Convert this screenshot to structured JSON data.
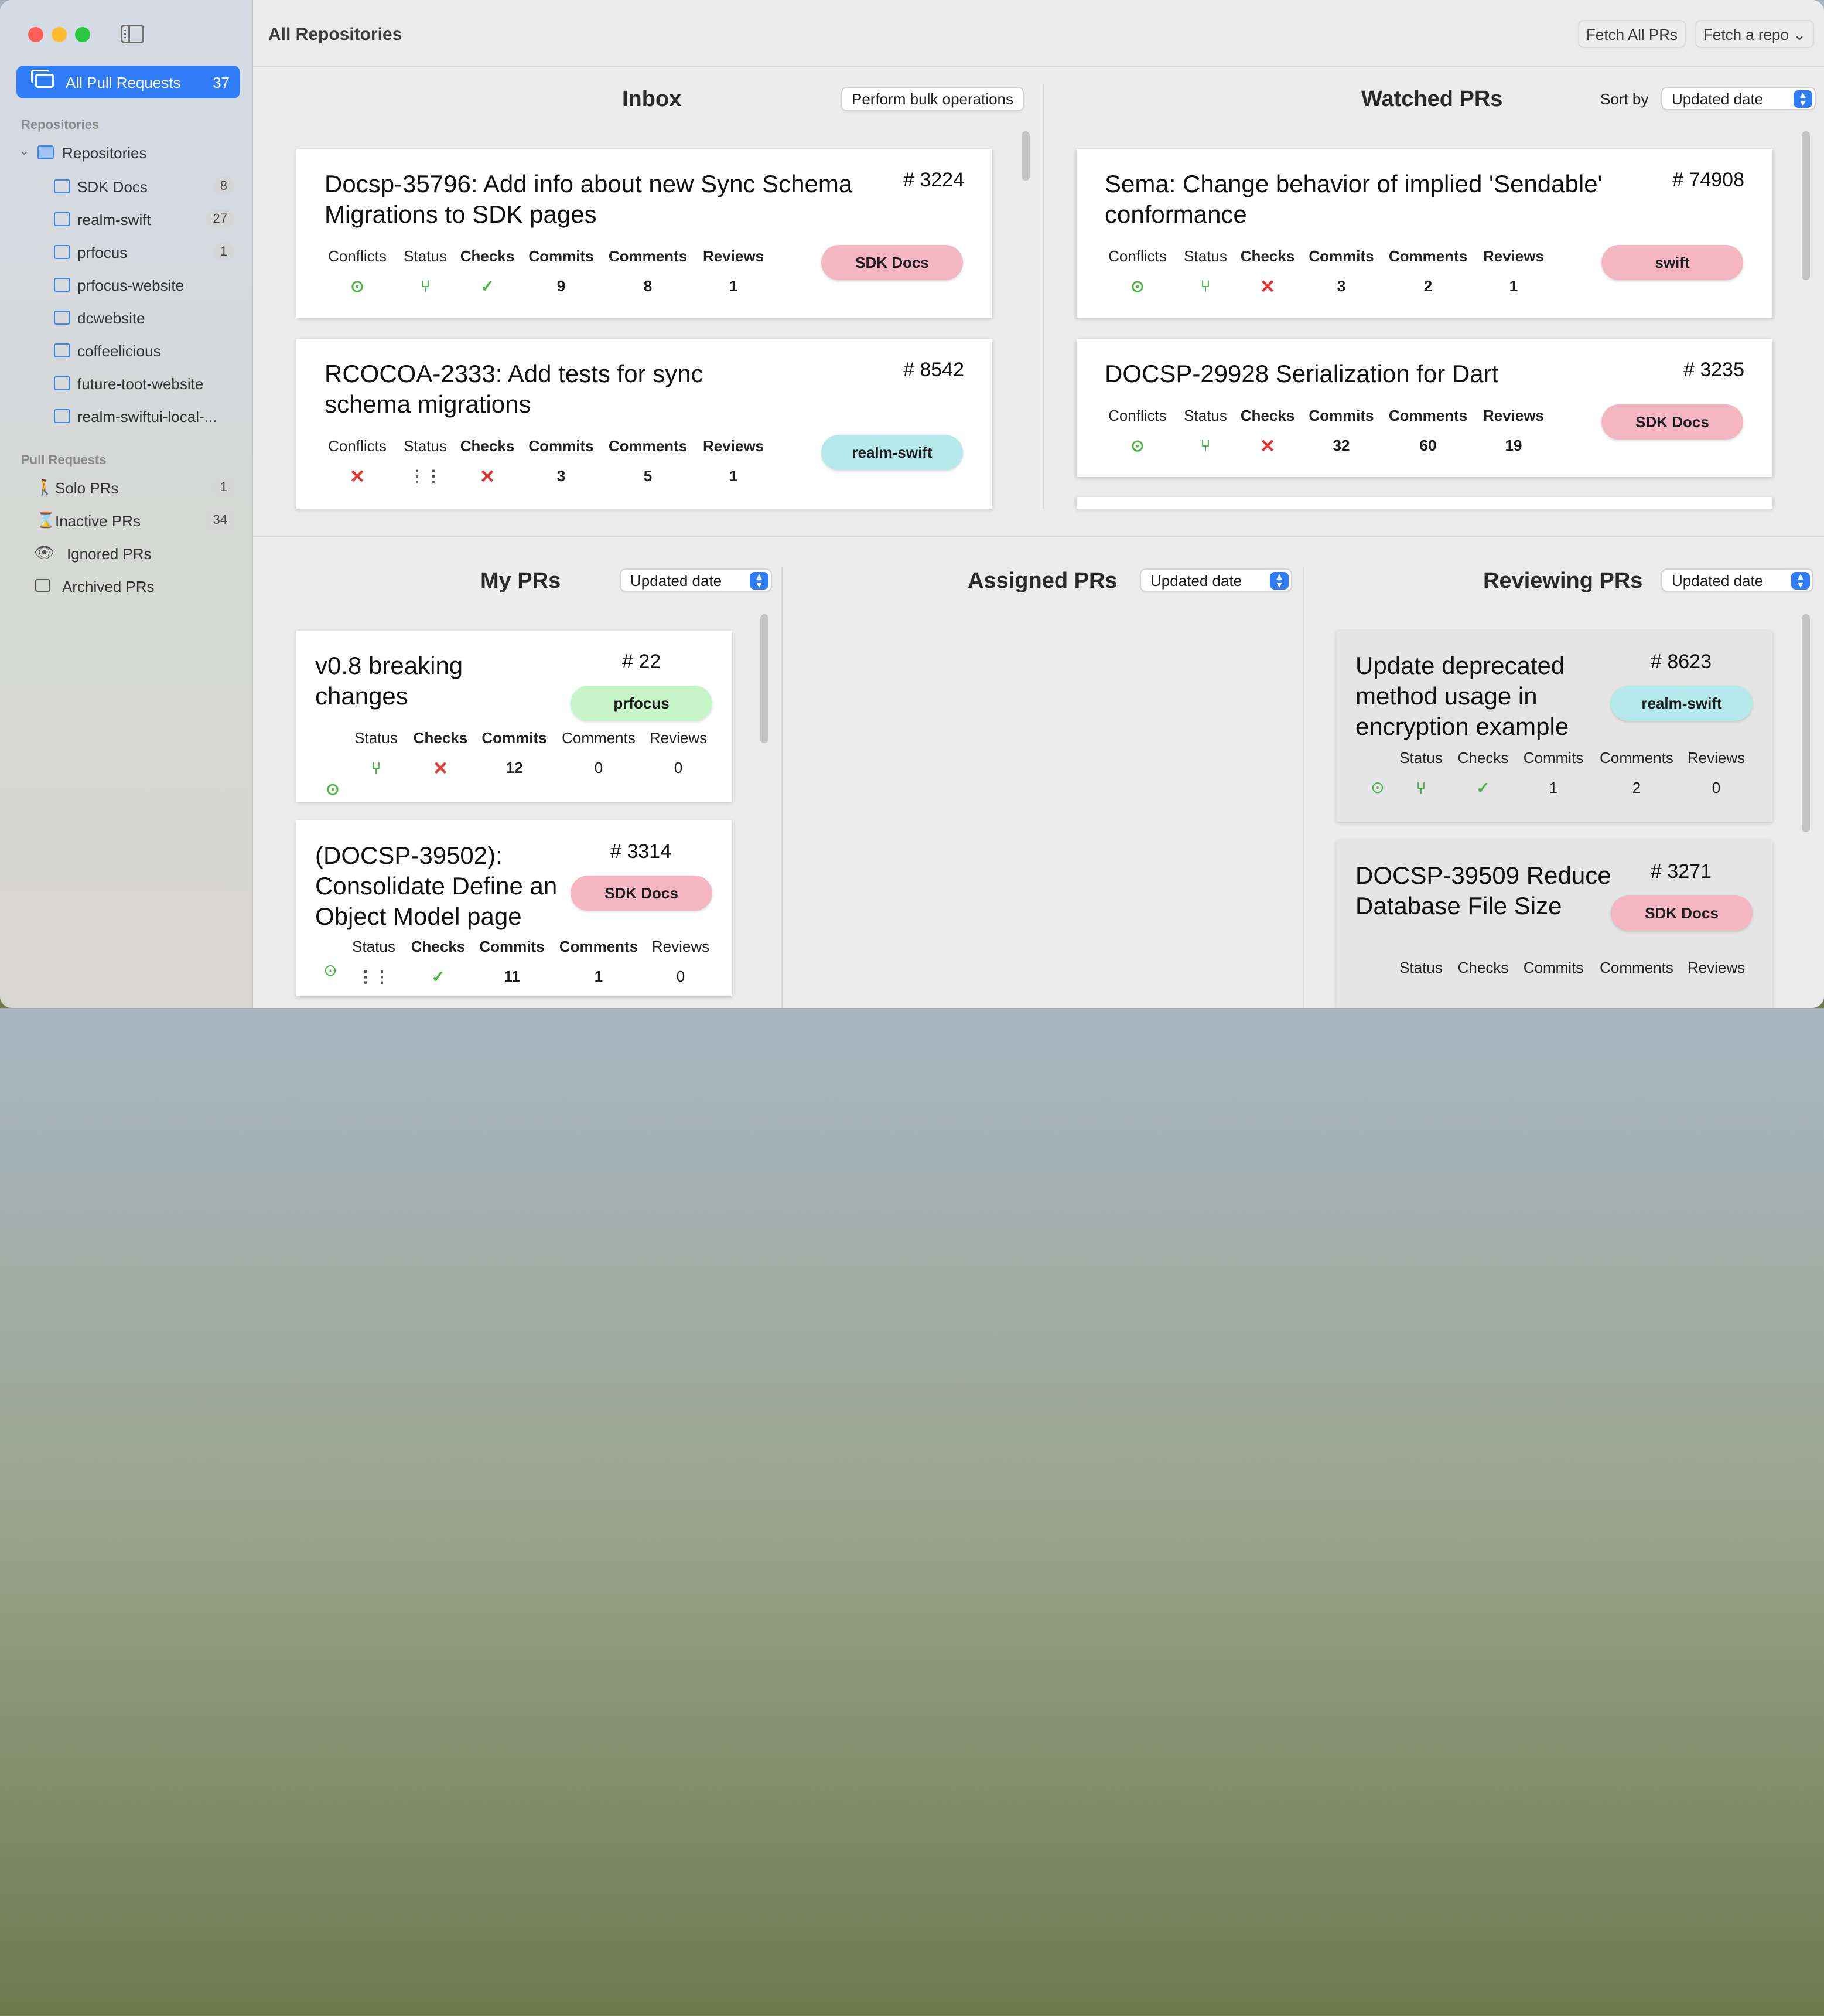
{
  "sidebar": {
    "all_prs": {
      "label": "All Pull Requests",
      "count": "37"
    },
    "repositories_section": "Repositories",
    "repositories_group": "Repositories",
    "repos": [
      {
        "label": "SDK Docs",
        "count": "8"
      },
      {
        "label": "realm-swift",
        "count": "27"
      },
      {
        "label": "prfocus",
        "count": "1"
      },
      {
        "label": "prfocus-website",
        "count": ""
      },
      {
        "label": "dcwebsite",
        "count": ""
      },
      {
        "label": "coffeelicious",
        "count": ""
      },
      {
        "label": "future-toot-website",
        "count": ""
      },
      {
        "label": "realm-swiftui-local-...",
        "count": ""
      }
    ],
    "pull_requests_section": "Pull Requests",
    "pr_filters": [
      {
        "label": "Solo PRs",
        "count": "1",
        "icon": "walking-person-icon"
      },
      {
        "label": "Inactive PRs",
        "count": "34",
        "icon": "hourglass-icon"
      },
      {
        "label": "Ignored PRs",
        "count": "",
        "icon": "eye-slash-icon"
      },
      {
        "label": "Archived PRs",
        "count": "",
        "icon": "archive-box-icon"
      }
    ]
  },
  "toolbar": {
    "title": "All Repositories",
    "fetch_all": "Fetch All PRs",
    "fetch_repo": "Fetch a repo ⌄"
  },
  "inbox": {
    "title": "Inbox",
    "bulk_button": "Perform bulk operations",
    "cards": [
      {
        "title": "Docsp-35796: Add info about new Sync Schema Migrations to SDK pages",
        "number": "# 3224",
        "tag": "SDK Docs",
        "conflicts": "ok",
        "status": "merged",
        "checks": "pass",
        "commits": "9",
        "comments": "8",
        "reviews": "1"
      },
      {
        "title": "RCOCOA-2333: Add tests for sync schema migrations",
        "number": "# 8542",
        "tag": "realm-swift",
        "conflicts": "fail",
        "status": "open",
        "checks": "fail",
        "commits": "3",
        "comments": "5",
        "reviews": "1"
      }
    ]
  },
  "watched": {
    "title": "Watched PRs",
    "sort_label": "Sort by",
    "sort_value": "Updated date",
    "cards": [
      {
        "title": "Sema: Change behavior of implied 'Sendable' conformance",
        "number": "# 74908",
        "tag": "swift",
        "conflicts": "ok",
        "status": "merged",
        "checks": "fail",
        "commits": "3",
        "comments": "2",
        "reviews": "1"
      },
      {
        "title": "DOCSP-29928 Serialization for Dart",
        "number": "# 3235",
        "tag": "SDK Docs",
        "conflicts": "ok",
        "status": "merged",
        "checks": "fail",
        "commits": "32",
        "comments": "60",
        "reviews": "19"
      }
    ]
  },
  "labels": {
    "conflicts": "Conflicts",
    "status": "Status",
    "checks": "Checks",
    "commits": "Commits",
    "comments": "Comments",
    "reviews": "Reviews"
  },
  "my_prs": {
    "title": "My PRs",
    "sort_value": "Updated date",
    "cards": [
      {
        "title": "v0.8 breaking changes",
        "number": "# 22",
        "tag": "prfocus",
        "commits": "12",
        "comments": "0",
        "reviews": "0"
      },
      {
        "title": "(DOCSP-39502): Consolidate Define an Object Model page",
        "number": "# 3314",
        "tag": "SDK Docs",
        "commits": "11",
        "comments": "1",
        "reviews": "0"
      }
    ]
  },
  "assigned": {
    "title": "Assigned PRs",
    "sort_value": "Updated date"
  },
  "reviewing": {
    "title": "Reviewing PRs",
    "sort_value": "Updated date",
    "cards": [
      {
        "title": "Update deprecated method usage in encryption example",
        "number": "# 8623",
        "tag": "realm-swift",
        "commits": "1",
        "comments": "2",
        "reviews": "0"
      },
      {
        "title": "DOCSP-39509 Reduce Database File Size",
        "number": "# 3271",
        "tag": "SDK Docs"
      }
    ]
  },
  "colors": {
    "accent": "#2f7cf6",
    "pass": "#4cb548",
    "fail": "#e0342c",
    "tag_pink": "#f4b6c1",
    "tag_cyan": "#b6e9ec",
    "tag_green": "#c8f4c9"
  }
}
